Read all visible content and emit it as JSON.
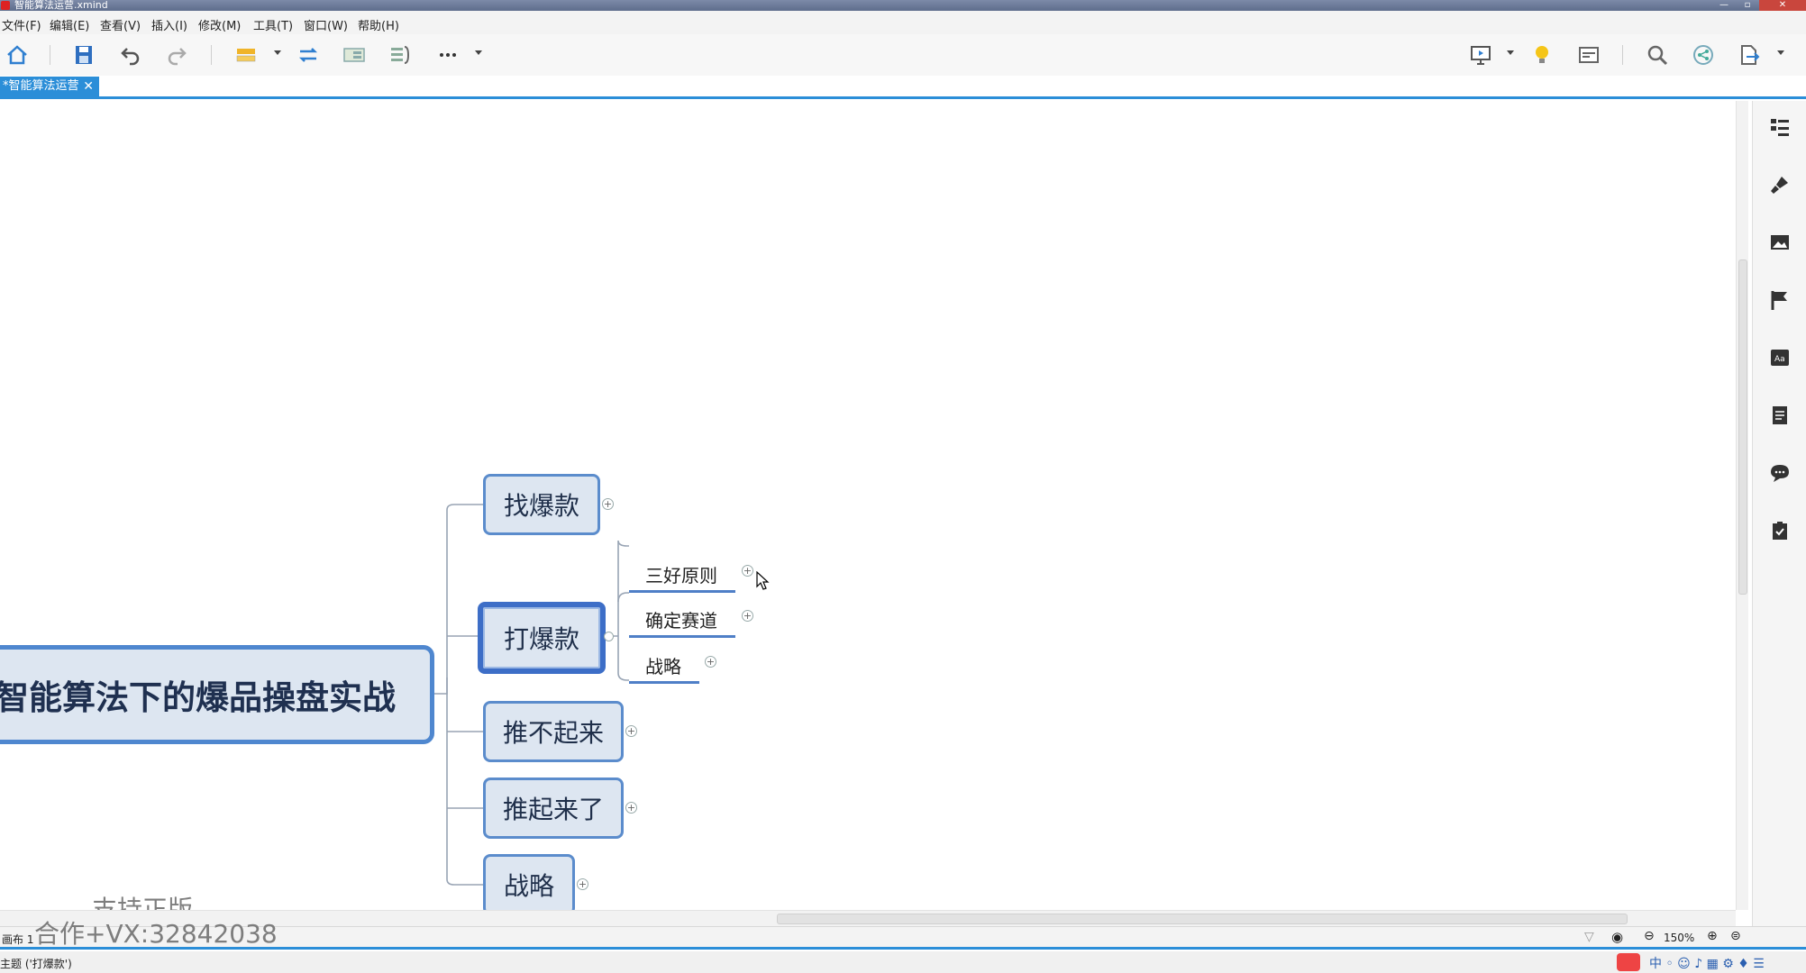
{
  "window": {
    "title": "智能算法运营.xmind"
  },
  "menu": [
    "文件(F)",
    "编辑(E)",
    "查看(V)",
    "插入(I)",
    "修改(M)",
    "工具(T)",
    "窗口(W)",
    "帮助(H)"
  ],
  "toolbar": {
    "left_icons": [
      "home-icon",
      "save-icon",
      "undo-icon",
      "redo-icon",
      "topic-icon",
      "relationship-icon",
      "boundary-icon",
      "summary-icon",
      "more-icon"
    ],
    "right_icons": [
      "presentation-icon",
      "idea-icon",
      "outline-view-icon",
      "search-icon",
      "share-icon",
      "export-icon"
    ]
  },
  "tab": {
    "label": "*智能算法运营"
  },
  "mindmap": {
    "root": "智能算法下的爆品操盘实战",
    "branches": [
      {
        "label": "找爆款"
      },
      {
        "label": "打爆款",
        "selected": true,
        "children": [
          "三好原则",
          "确定赛道",
          "战略"
        ]
      },
      {
        "label": "推不起来"
      },
      {
        "label": "推起来了"
      },
      {
        "label": "战略"
      }
    ]
  },
  "right_panel_icons": [
    "outline-panel-icon",
    "format-brush-icon",
    "image-icon",
    "marker-flag-icon",
    "font-panel-icon",
    "notes-icon",
    "comments-icon",
    "task-icon"
  ],
  "sheet": {
    "label": "画布 1",
    "zoom": "150%"
  },
  "status": {
    "text": "主题 ('打爆款')"
  },
  "watermark": {
    "line1": "支持正版",
    "line2": "合作+VX:32842038"
  }
}
